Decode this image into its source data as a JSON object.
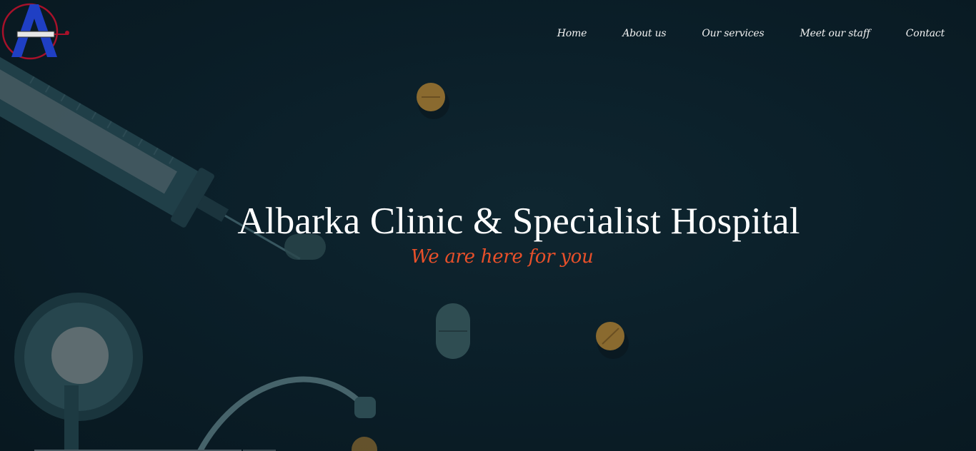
{
  "brand": {
    "logo_letter": "A"
  },
  "nav": {
    "items": [
      {
        "label": "Home"
      },
      {
        "label": "About us"
      },
      {
        "label": "Our services"
      },
      {
        "label": "Meet our staff"
      },
      {
        "label": "Contact"
      }
    ]
  },
  "hero": {
    "title": "Albarka Clinic & Specialist Hospital",
    "tagline": "We are here for you"
  },
  "colors": {
    "background": "#0b1f29",
    "title": "#ffffff",
    "tagline": "#e8502a",
    "logo_blue": "#1f3fc4",
    "logo_red": "#a8112a"
  },
  "icons": {
    "logo": "clinic-logo-icon"
  }
}
